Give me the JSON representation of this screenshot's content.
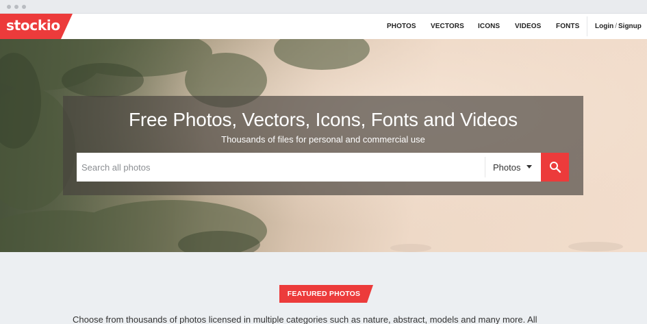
{
  "colors": {
    "brand": "#ec3b3b",
    "nav_text": "#222222",
    "section_bg": "#eceff2"
  },
  "logo": {
    "text": "stockio"
  },
  "nav": {
    "items": [
      {
        "label": "PHOTOS"
      },
      {
        "label": "VECTORS"
      },
      {
        "label": "ICONS"
      },
      {
        "label": "VIDEOS"
      },
      {
        "label": "FONTS"
      }
    ],
    "login_label": "Login",
    "separator": "/",
    "signup_label": "Signup"
  },
  "hero": {
    "title": "Free Photos, Vectors, Icons, Fonts and Videos",
    "subtitle": "Thousands of files for personal and commercial use",
    "search": {
      "placeholder": "Search all photos",
      "value": "",
      "category_selected": "Photos",
      "button_icon": "search-icon"
    }
  },
  "featured": {
    "badge_label": "FEATURED PHOTOS",
    "description": "Choose from thousands of photos licensed in multiple categories such as nature, abstract, models and many more. All"
  }
}
